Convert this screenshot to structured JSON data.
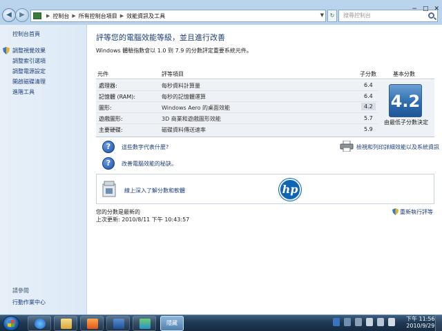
{
  "window": {
    "breadcrumb": [
      "控制台",
      "所有控制台項目",
      "效能資訊及工具"
    ],
    "search_placeholder": "搜尋控制台",
    "controls": [
      "−",
      "□",
      "✕"
    ]
  },
  "left_pane": {
    "links": [
      "控制台首頁",
      "調整視覺效果",
      "調整索引選項",
      "調整電源設定",
      "開啟磁碟清理",
      "進階工具"
    ],
    "see_also_title": "請參閱",
    "see_also_links": [
      "行動作業中心"
    ]
  },
  "content": {
    "title": "評等您的電腦效能等級，並且進行改善",
    "subtitle": "Windows 體驗指數會以 1.0 到 7.9 的分數評定重要系統元件。",
    "table": {
      "headers": [
        "元件",
        "評等項目",
        "子分數",
        "基本分數"
      ],
      "rows": [
        {
          "component": "處理器:",
          "item": "每秒資料計算量",
          "score": "6.4"
        },
        {
          "component": "記憶體 (RAM):",
          "item": "每秒的記憶體運算",
          "score": "6.4"
        },
        {
          "component": "圖形:",
          "item": "Windows Aero 的桌面效能",
          "score": "4.2"
        },
        {
          "component": "遊戲圖形:",
          "item": "3D 商業和遊戲圖形效能",
          "score": "5.7"
        },
        {
          "component": "主要硬碟:",
          "item": "磁碟資料傳送速率",
          "score": "5.9"
        }
      ],
      "base_score": "4.2",
      "base_caption": "由最低子分數決定"
    },
    "help_links": [
      "這些數字代表什麼?",
      "改善電腦效能的秘訣。"
    ],
    "print_link": "檢視和列印詳細效能以及系統資訊",
    "promo_link": "線上深入了解分數和軟體",
    "promo_logo": "hp",
    "status_line1": "您的分數是最新的",
    "status_line2": "上次更新: 2010/8/11 下午 10:43:57",
    "rerun_link": "重新執行評等"
  },
  "taskbar": {
    "active_label": "隱藏",
    "time": "下午 11:56",
    "date": "2010/9/29"
  }
}
